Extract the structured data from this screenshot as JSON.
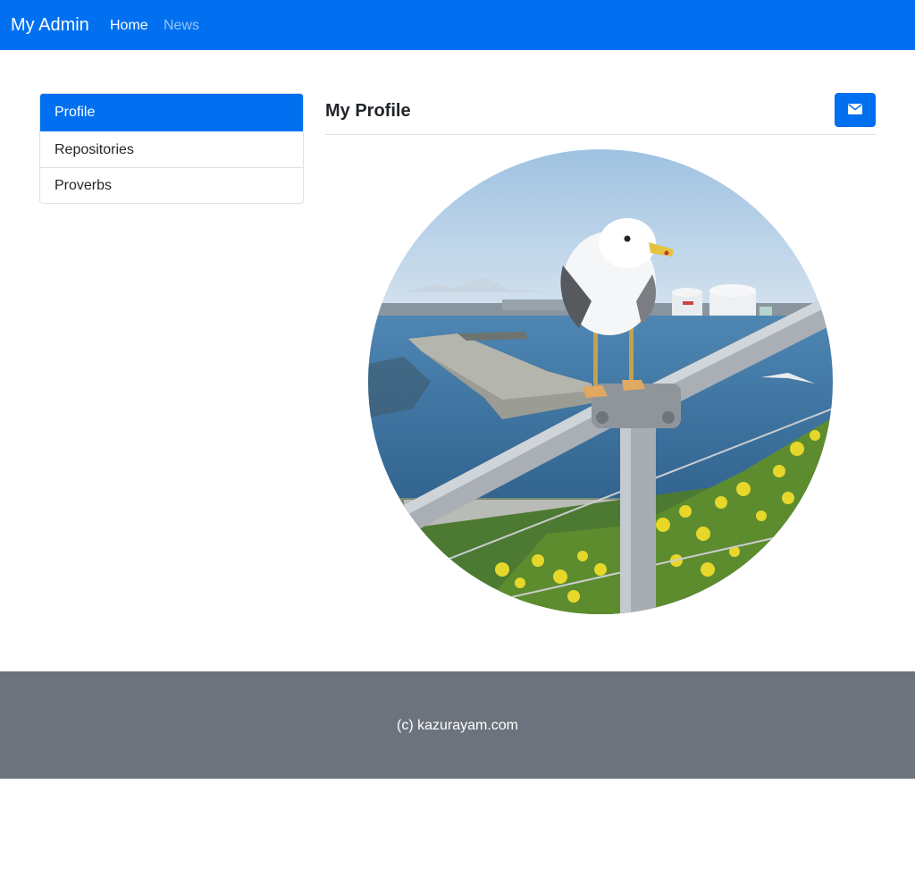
{
  "navbar": {
    "brand": "My Admin",
    "links": [
      {
        "label": "Home",
        "active": true
      },
      {
        "label": "News",
        "active": false
      }
    ],
    "background_color": "#0070f0"
  },
  "sidebar": {
    "items": [
      {
        "label": "Profile",
        "active": true
      },
      {
        "label": "Repositories",
        "active": false
      },
      {
        "label": "Proverbs",
        "active": false
      }
    ]
  },
  "main": {
    "title": "My Profile",
    "mail_button_icon": "envelope-icon",
    "avatar": {
      "subject": "seagull perched on a metal railing by the sea",
      "shape": "circle"
    }
  },
  "footer": {
    "text": "(c) kazurayam.com",
    "background_color": "#6c737d"
  }
}
